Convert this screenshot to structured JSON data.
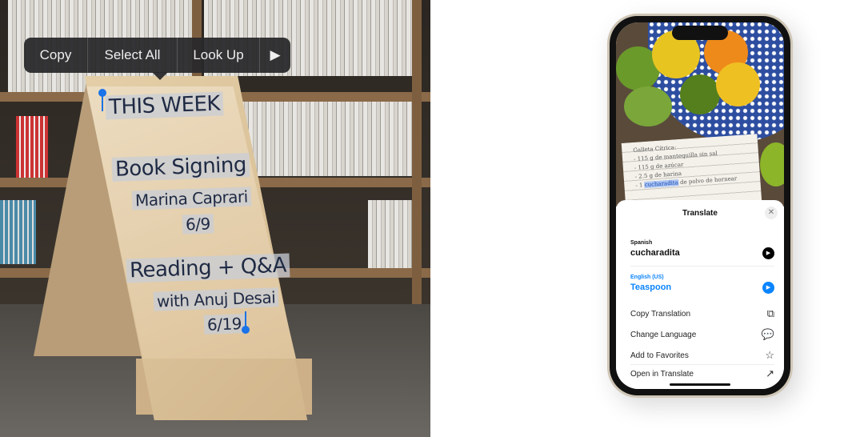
{
  "context_menu": {
    "items": [
      "Copy",
      "Select All",
      "Look Up"
    ],
    "more_icon": "play-triangle-icon"
  },
  "sign": {
    "lines": [
      "THIS WEEK",
      "Book Signing",
      "Marina Caprari",
      "6/9",
      "Reading + Q&A",
      "with Anuj Desai",
      "6/19"
    ]
  },
  "notebook": {
    "lines": [
      "Galleta Cítrica:",
      "- 115 g de mantequilla sin sal",
      "- 115 g de azúcar",
      "- 2.5 g de harina",
      "de polvo de hornear"
    ],
    "selected": "cucharadita"
  },
  "translate": {
    "title": "Translate",
    "source_lang": "Spanish",
    "source_text": "cucharadita",
    "target_lang": "English (US)",
    "target_text": "Teaspoon",
    "actions": [
      {
        "label": "Copy Translation",
        "icon": "copy-icon"
      },
      {
        "label": "Change Language",
        "icon": "translate-bubble-icon"
      },
      {
        "label": "Add to Favorites",
        "icon": "star-icon"
      },
      {
        "label": "Open in Translate",
        "icon": "open-external-icon"
      }
    ],
    "accent": "#0a84ff"
  }
}
